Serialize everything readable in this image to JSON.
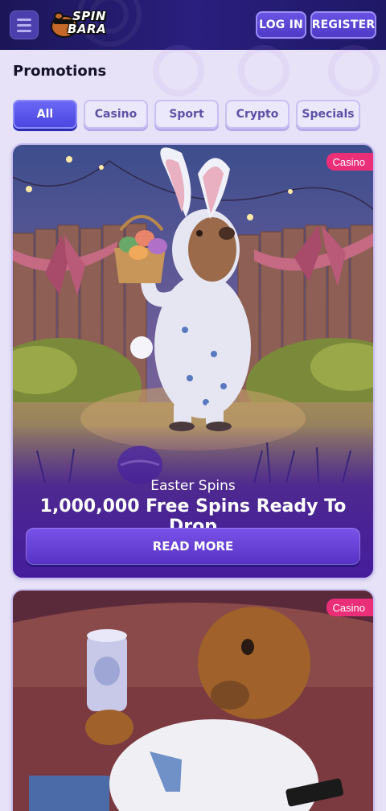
{
  "header": {
    "logo_line1": "SPIN",
    "logo_line2": "BARA",
    "login_label": "LOG IN",
    "register_label": "REGISTER"
  },
  "page": {
    "title": "Promotions"
  },
  "filters": [
    {
      "label": "All",
      "active": true
    },
    {
      "label": "Casino",
      "active": false
    },
    {
      "label": "Sport",
      "active": false
    },
    {
      "label": "Crypto",
      "active": false
    },
    {
      "label": "Specials",
      "active": false
    }
  ],
  "promotions": [
    {
      "badge": "Casino",
      "subtitle": "Easter Spins",
      "title": "1,000,000 Free Spins Ready To Drop",
      "cta": "READ MORE"
    },
    {
      "badge": "Casino"
    }
  ],
  "colors": {
    "header_bg": "#1f1866",
    "accent": "#4944df",
    "badge": "#ea2f78",
    "page_bg": "#e7e2f7"
  },
  "icons": [
    "menu-icon"
  ]
}
